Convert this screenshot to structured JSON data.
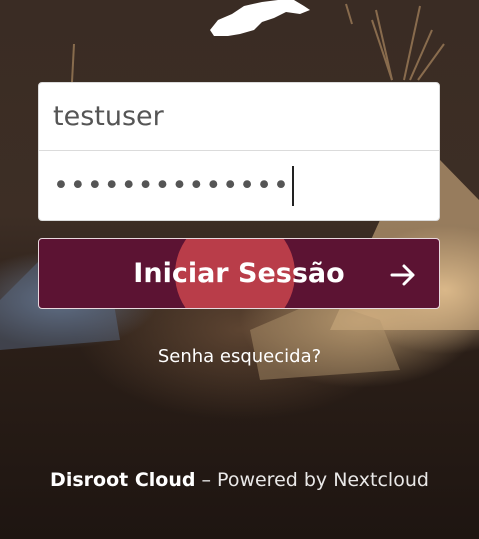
{
  "login": {
    "username_value": "testuser",
    "password_value": "••••••••••••••",
    "submit_label": "Iniciar Sessão",
    "forgot_label": "Senha esquecida?"
  },
  "footer": {
    "brand": "Disroot Cloud",
    "separator": "–",
    "powered_by": "Powered by Nextcloud"
  },
  "colors": {
    "button_bg": "#5c1333",
    "ripple": "#de4e52",
    "text_light": "#ffffff",
    "field_bg": "#ffffff"
  },
  "icons": {
    "submit_arrow": "arrow-right-icon",
    "logo": "disroot-logo"
  }
}
